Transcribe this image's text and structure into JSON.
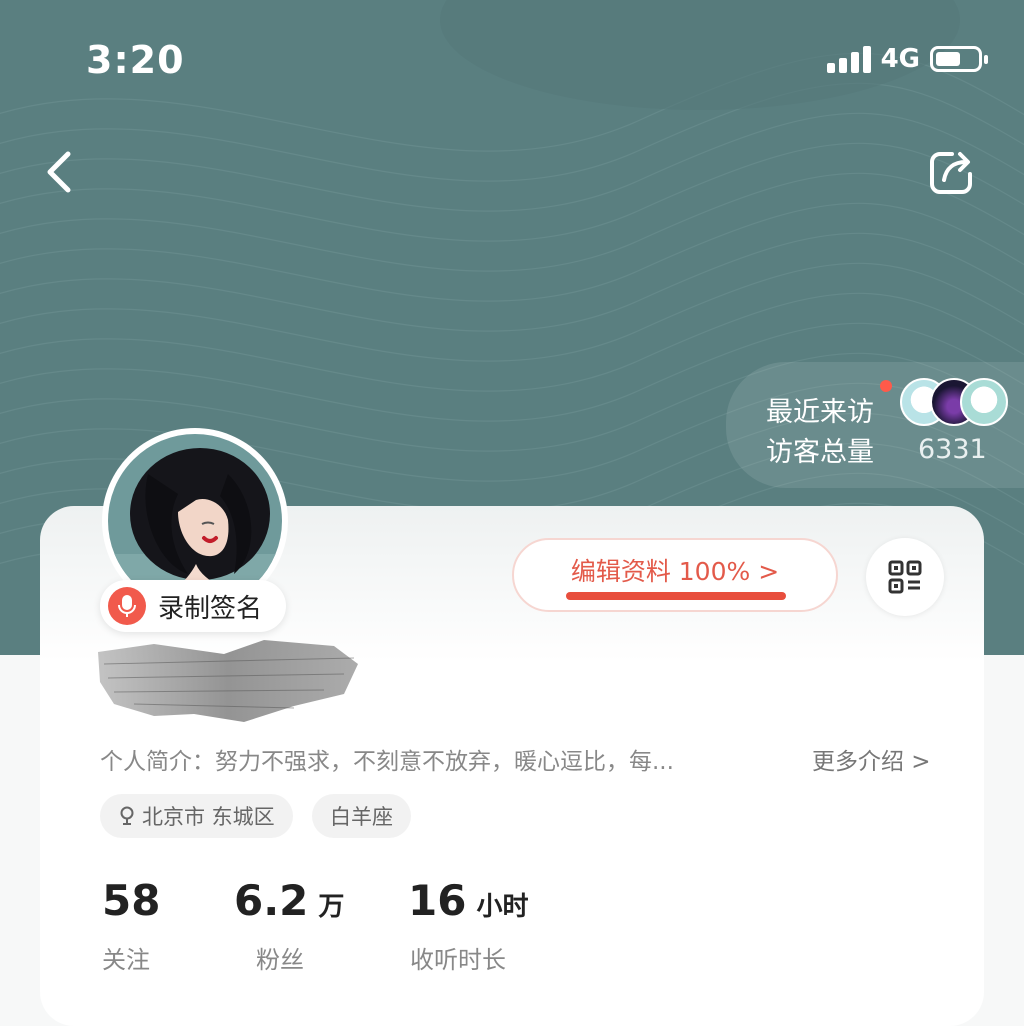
{
  "status_bar": {
    "time": "3:20",
    "network": "4G"
  },
  "header": {
    "back_icon": "chevron-left-icon",
    "share_icon": "share-icon"
  },
  "visitors": {
    "recent_label": "最近来访",
    "total_label": "访客总量",
    "total_count": "6331"
  },
  "profile": {
    "record_label": "录制签名",
    "edit_label": "编辑资料 100% >",
    "edit_progress": 1.0,
    "bio": "个人简介：努力不强求，不刻意不放弃，暖心逗比，每...",
    "more_label": "更多介绍 >",
    "tags": {
      "location": "北京市 东城区",
      "zodiac": "白羊座"
    }
  },
  "stats": {
    "following": {
      "value": "58",
      "unit": "",
      "label": "关注"
    },
    "fans": {
      "value": "6.2",
      "unit": "万",
      "label": "粉丝"
    },
    "listen": {
      "value": "16",
      "unit": "小时",
      "label": "收听时长"
    }
  },
  "colors": {
    "header_bg": "#5a7f80",
    "accent": "#e84e3d"
  }
}
